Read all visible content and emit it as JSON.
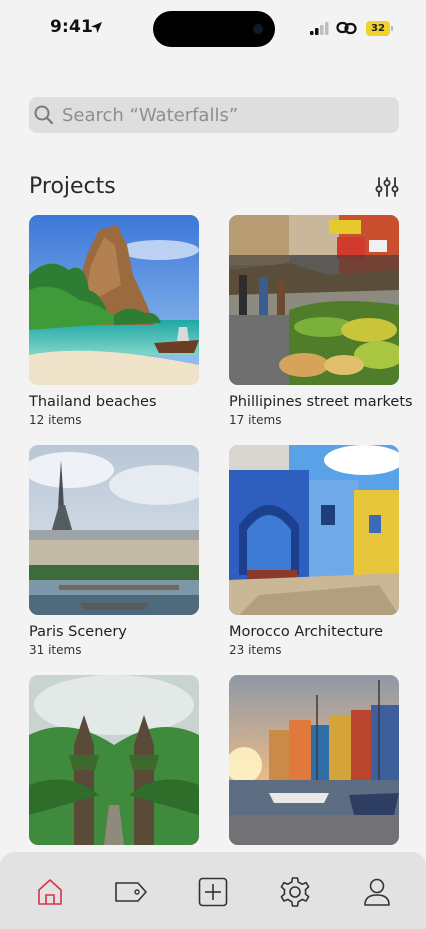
{
  "status_bar": {
    "time": "9:41",
    "battery": "32"
  },
  "search": {
    "placeholder": "Search “Waterfalls”"
  },
  "projects": {
    "title": "Projects",
    "items": [
      {
        "title": "Thailand beaches",
        "count": "12 items"
      },
      {
        "title": "Phillipines street markets",
        "count": "17 items"
      },
      {
        "title": "Paris Scenery",
        "count": "31 items"
      },
      {
        "title": "Morocco Architecture",
        "count": "23 items"
      },
      {
        "title": "",
        "count": ""
      },
      {
        "title": "",
        "count": ""
      }
    ]
  },
  "tab_bar": {
    "items": [
      "home-icon",
      "tag-icon",
      "add-icon",
      "settings-icon",
      "profile-icon"
    ],
    "active": "home-icon",
    "active_color": "#d8324a",
    "inactive_color": "#333333"
  }
}
